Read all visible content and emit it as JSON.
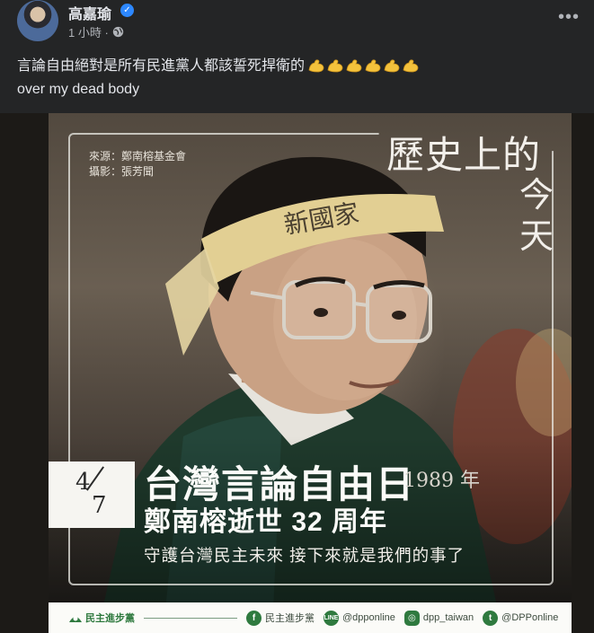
{
  "post": {
    "author": "高嘉瑜",
    "time": "1 小時 ·",
    "text_line1": "言論自由絕對是所有民進黨人都該誓死捍衛的",
    "emoji_count": 6,
    "text_line2": "over my dead body"
  },
  "image": {
    "source_line1": "來源：鄭南榕基金會",
    "source_line2": "攝影：張芳聞",
    "title_history": "歷史上的",
    "title_today": "今天",
    "headband_text": "新國家",
    "date_month": "4",
    "date_day": "7",
    "day_name": "台灣言論自由日",
    "year": "1989 年",
    "anniversary": "鄭南榕逝世 32 周年",
    "slogan": "守護台灣民主未來  接下來就是我們的事了",
    "footer": {
      "logo_text": "民主進步黨",
      "facebook": "民主進步黨",
      "line": "@dpponline",
      "instagram": "dpp_taiwan",
      "twitter": "@DPPonline"
    }
  },
  "colors": {
    "background": "#18191a",
    "card": "#242526",
    "text": "#e4e6eb",
    "meta": "#b0b3b8",
    "verified": "#2d88ff",
    "dpp_green": "#2f7a3f"
  }
}
